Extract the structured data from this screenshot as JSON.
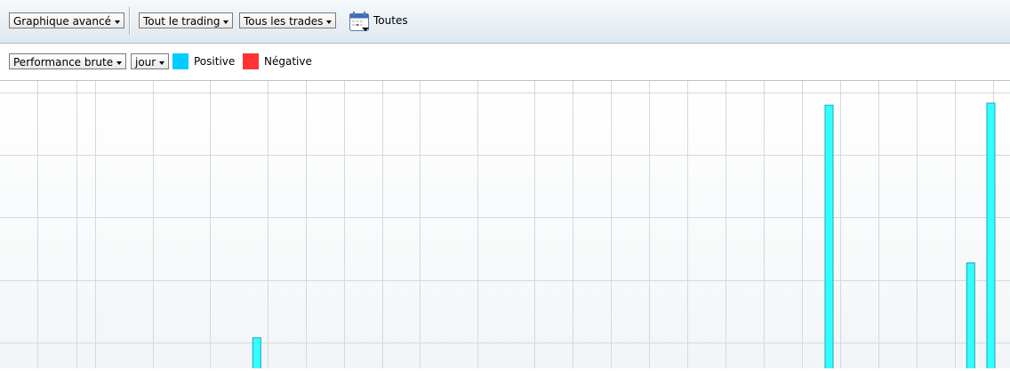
{
  "toolbar": {
    "chart_mode": "Graphique avancé",
    "trading_scope": "Tout le trading",
    "trades_filter": "Tous les trades",
    "calendar_icon": "calendar-icon",
    "period_label": "Toutes"
  },
  "subbar": {
    "metric": "Performance brute",
    "interval": "jour",
    "legend": [
      {
        "label": "Positive",
        "color": "#00ccff"
      },
      {
        "label": "Négative",
        "color": "#ff3333"
      }
    ]
  },
  "chart_data": {
    "type": "bar",
    "title": "",
    "xlabel": "",
    "ylabel": "",
    "grid": true,
    "legend": "top-left",
    "bar_color": "#33ffff",
    "notes_visible_bars_only": true,
    "x_slots": 26,
    "bars": [
      {
        "slot": 6.25,
        "value": 1.0
      },
      {
        "slot": 20.4,
        "value": 6.9
      },
      {
        "slot": 23.9,
        "value": 2.9
      },
      {
        "slot": 24.4,
        "value": 6.95
      }
    ],
    "ylim": [
      0,
      7.4
    ]
  }
}
